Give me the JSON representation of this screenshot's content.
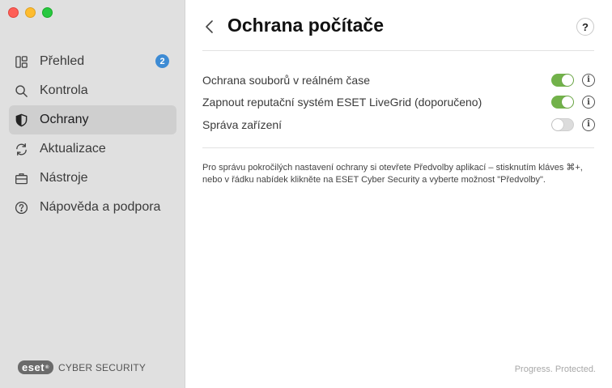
{
  "window": {
    "title": "Ochrana počítače"
  },
  "sidebar": {
    "items": [
      {
        "label": "Přehled",
        "icon": "dashboard-icon",
        "badge": "2"
      },
      {
        "label": "Kontrola",
        "icon": "search-icon"
      },
      {
        "label": "Ochrany",
        "icon": "shield-icon",
        "active": true
      },
      {
        "label": "Aktualizace",
        "icon": "refresh-icon"
      },
      {
        "label": "Nástroje",
        "icon": "briefcase-icon"
      },
      {
        "label": "Nápověda a podpora",
        "icon": "help-circle-icon"
      }
    ],
    "brand": {
      "logo": "eset",
      "product": "CYBER SECURITY"
    }
  },
  "header": {
    "title": "Ochrana počítače",
    "help_label": "?"
  },
  "settings": [
    {
      "label": "Ochrana souborů v reálném čase",
      "enabled": true
    },
    {
      "label": "Zapnout reputační systém ESET LiveGrid (doporučeno)",
      "enabled": true
    },
    {
      "label": "Správa zařízení",
      "enabled": false
    }
  ],
  "note": "Pro správu pokročilých nastavení ochrany si otevřete Předvolby aplikací – stisknutím kláves ⌘+, nebo v řádku nabídek klikněte na ESET Cyber Security a vyberte možnost \"Předvolby\".",
  "footer": {
    "tagline": "Progress. Protected."
  },
  "colors": {
    "accent_toggle": "#72b24a",
    "badge": "#3d8bd4",
    "sidebar_bg": "#e0e0e0"
  }
}
